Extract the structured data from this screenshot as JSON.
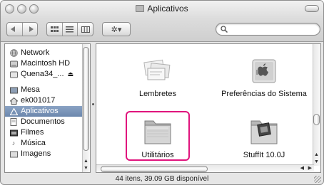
{
  "window": {
    "title": "Aplicativos"
  },
  "toolbar": {
    "back_icon": "◀",
    "forward_icon": "▶",
    "view_icons": "icon-view",
    "view_list": "list-view",
    "view_columns": "column-view",
    "action_label": "✲▾",
    "search_placeholder": ""
  },
  "sidebar": {
    "devices": [
      {
        "label": "Network",
        "icon": "globe-icon"
      },
      {
        "label": "Macintosh HD",
        "icon": "hard-drive-icon"
      },
      {
        "label": "Quena34_...",
        "icon": "disk-icon"
      }
    ],
    "places": [
      {
        "label": "Mesa",
        "icon": "desktop-icon"
      },
      {
        "label": "ek001017",
        "icon": "home-icon"
      },
      {
        "label": "Aplicativos",
        "icon": "applications-icon",
        "selected": true
      },
      {
        "label": "Documentos",
        "icon": "documents-icon"
      },
      {
        "label": "Filmes",
        "icon": "movies-icon"
      },
      {
        "label": "Música",
        "icon": "music-icon"
      },
      {
        "label": "Imagens",
        "icon": "pictures-icon"
      }
    ]
  },
  "items": [
    {
      "label": "Lembretes",
      "icon": "stickies-icon"
    },
    {
      "label": "Preferências do Sistema",
      "icon": "system-preferences-icon"
    },
    {
      "label": "Utilitários",
      "icon": "utilities-folder-icon",
      "highlighted": true
    },
    {
      "label": "StuffIt 10.0J",
      "icon": "stuffit-folder-icon"
    }
  ],
  "status_bar": {
    "text": "44 itens, 39.09 GB disponível"
  },
  "colors": {
    "highlight": "#e0147d",
    "selection": "#6c87ad"
  }
}
